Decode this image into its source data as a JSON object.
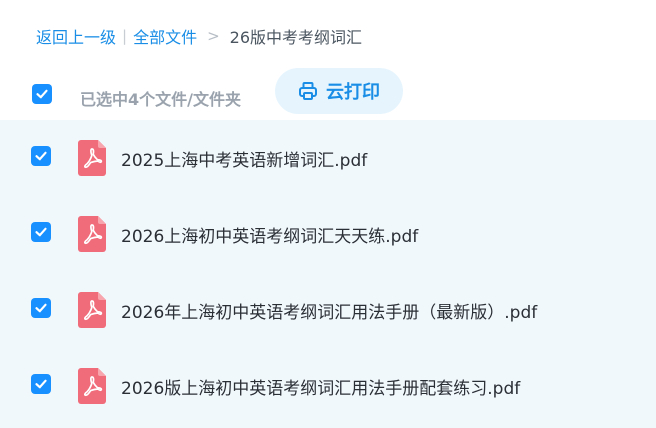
{
  "breadcrumb": {
    "back": "返回上一级",
    "separator": "|",
    "all_files": "全部文件",
    "arrow": ">",
    "current": "26版中考考纲词汇"
  },
  "toolbar": {
    "selected_text": "已选中4个文件/文件夹",
    "print_label": "云打印"
  },
  "files": [
    {
      "name": "2025上海中考英语新增词汇.pdf",
      "checked": true
    },
    {
      "name": "2026上海初中英语考纲词汇天天练.pdf",
      "checked": true
    },
    {
      "name": "2026年上海初中英语考纲词汇用法手册（最新版）.pdf",
      "checked": true
    },
    {
      "name": "2026版上海初中英语考纲词汇用法手册配套练习.pdf",
      "checked": true
    }
  ],
  "colors": {
    "accent": "#1890ff",
    "link": "#1a8ee6",
    "pdf_icon": "#f06c7b",
    "list_background": "#f1f8fc"
  },
  "icons": {
    "select_all": "checkmark-icon",
    "print": "printer-icon",
    "file": "pdf-file-icon"
  }
}
